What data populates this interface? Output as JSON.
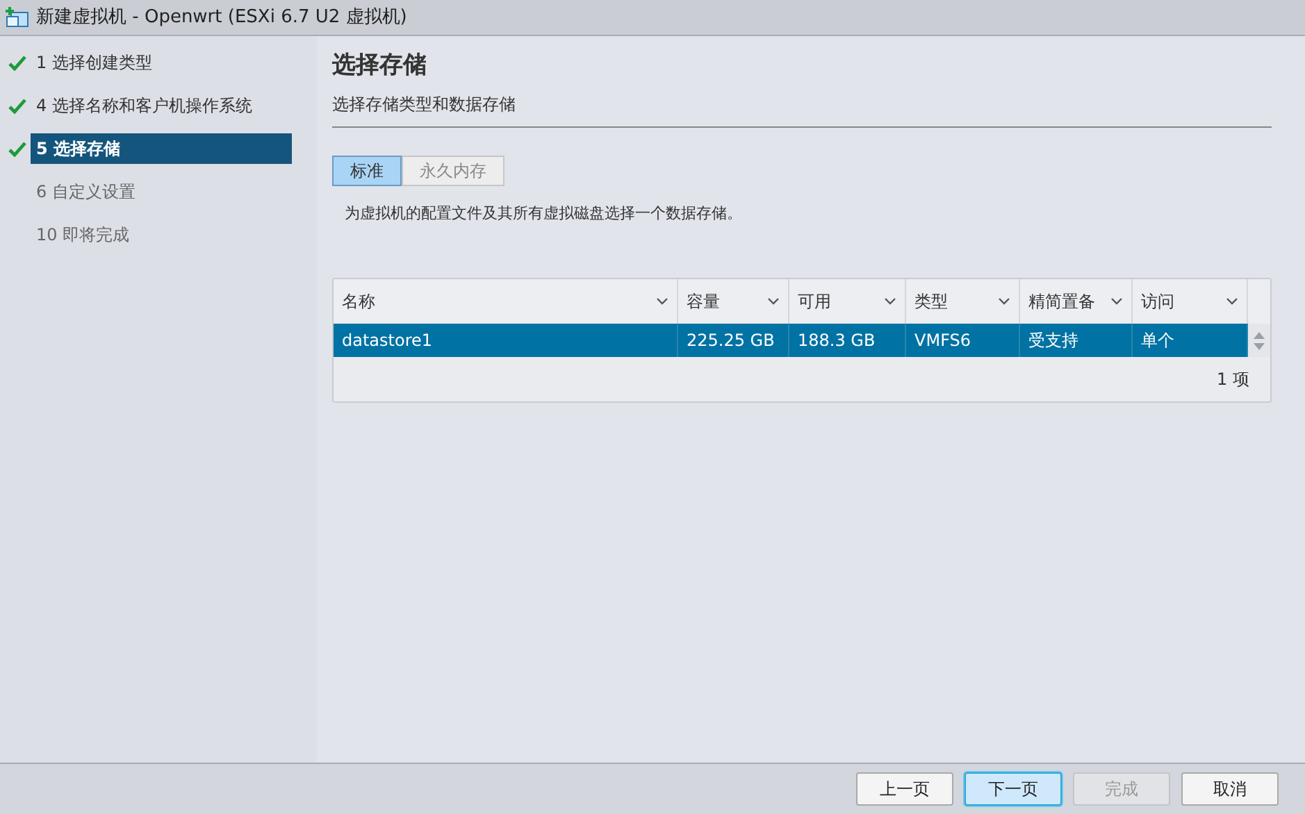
{
  "window": {
    "title": "新建虚拟机 - Openwrt (ESXi 6.7 U2 虚拟机)"
  },
  "steps": [
    {
      "label": "1 选择创建类型",
      "completed": true,
      "selected": false
    },
    {
      "label": "4 选择名称和客户机操作系统",
      "completed": true,
      "selected": false
    },
    {
      "label": "5 选择存储",
      "completed": true,
      "selected": true
    },
    {
      "label": "6 自定义设置",
      "completed": false,
      "selected": false
    },
    {
      "label": "10 即将完成",
      "completed": false,
      "selected": false
    }
  ],
  "page": {
    "title": "选择存储",
    "subtitle": "选择存储类型和数据存储"
  },
  "tabs": [
    {
      "label": "标准",
      "selected": true
    },
    {
      "label": "永久内存",
      "selected": false
    }
  ],
  "description": "为虚拟机的配置文件及其所有虚拟磁盘选择一个数据存储。",
  "table": {
    "columns": [
      "名称",
      "容量",
      "可用",
      "类型",
      "精简置备",
      "访问"
    ],
    "rows": [
      {
        "cells": [
          "datastore1",
          "225.25 GB",
          "188.3 GB",
          "VMFS6",
          "受支持",
          "单个"
        ],
        "selected": true
      }
    ],
    "footer": "1 项"
  },
  "buttons": [
    {
      "label": "上一页",
      "kind": "normal",
      "disabled": false
    },
    {
      "label": "下一页",
      "kind": "primary",
      "disabled": false
    },
    {
      "label": "完成",
      "kind": "normal",
      "disabled": true
    },
    {
      "label": "取消",
      "kind": "normal",
      "disabled": false
    }
  ]
}
